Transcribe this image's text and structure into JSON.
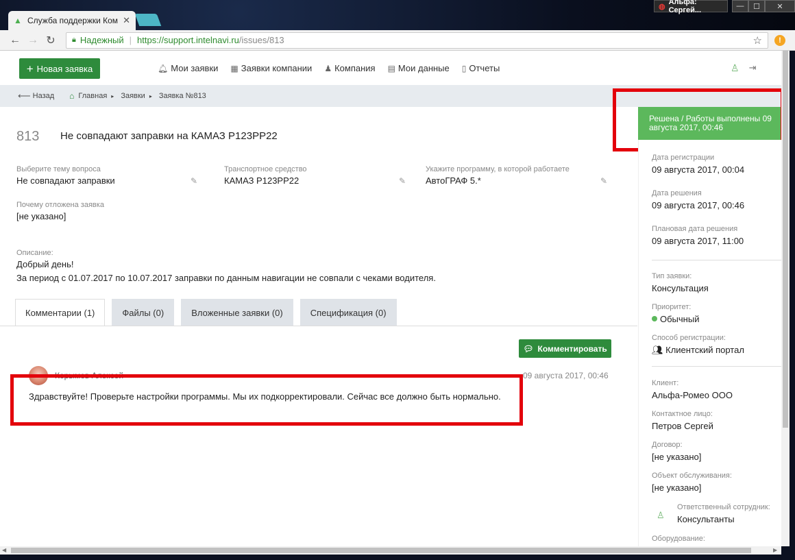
{
  "browser": {
    "tab_title": "Служба поддержки Ком",
    "user_badge": "Альфа: Сергей...",
    "secure_label": "Надежный",
    "url_host": "https://support.intelnavi.ru",
    "url_path": "/issues/813"
  },
  "topnav": {
    "new_request": "Новая заявка",
    "menu": [
      "Мои заявки",
      "Заявки компании",
      "Компания",
      "Мои данные",
      "Отчеты"
    ]
  },
  "breadcrumb": {
    "back": "Назад",
    "home": "Главная",
    "requests": "Заявки",
    "current": "Заявка №813"
  },
  "issue": {
    "number": "813",
    "title": "Не совпадают заправки на КАМАЗ Р123РР22",
    "status": "Решена / Работы выполнены 09 августа 2017, 00:46",
    "fields": {
      "topic_label": "Выберите тему вопроса",
      "topic_value": "Не совпадают заправки",
      "vehicle_label": "Транспортное средство",
      "vehicle_value": "КАМАЗ Р123РР22",
      "program_label": "Укажите программу, в которой работаете",
      "program_value": "АвтоГРАФ 5.*",
      "postponed_label": "Почему отложена заявка",
      "postponed_value": "[не указано]"
    },
    "description_label": "Описание:",
    "description_line1": "Добрый день!",
    "description_line2": "За период с 01.07.2017 по 10.07.2017 заправки по данным навигации не совпали с чеками водителя."
  },
  "tabs": [
    "Комментарии (1)",
    "Файлы (0)",
    "Вложенные заявки (0)",
    "Спецификация (0)"
  ],
  "comments": {
    "button": "Комментировать",
    "author": "Корымов Алексей",
    "date": "09 августа 2017, 00:46",
    "text": "Здравствуйте! Проверьте настройки программы. Мы их подкорректировали. Сейчас все должно быть нормально."
  },
  "sidebar": {
    "reg_date_label": "Дата регистрации",
    "reg_date": "09 августа 2017, 00:04",
    "resolve_date_label": "Дата решения",
    "resolve_date": "09 августа 2017, 00:46",
    "planned_label": "Плановая дата решения",
    "planned": "09 августа 2017, 11:00",
    "type_label": "Тип заявки:",
    "type": "Консультация",
    "priority_label": "Приоритет:",
    "priority": "Обычный",
    "reg_method_label": "Способ регистрации:",
    "reg_method": "Клиентский портал",
    "client_label": "Клиент:",
    "client": "Альфа-Ромео ООО",
    "contact_label": "Контактное лицо:",
    "contact": "Петров Сергей",
    "contract_label": "Договор:",
    "contract": "[не указано]",
    "object_label": "Объект обслуживания:",
    "object": "[не указано]",
    "responsible_label": "Ответственный сотрудник:",
    "responsible": "Консультанты",
    "equipment_label": "Оборудование:"
  },
  "colors": {
    "brand_green": "#2e8b3c",
    "status_green": "#5cb85c",
    "highlight_red": "#e3000b"
  }
}
